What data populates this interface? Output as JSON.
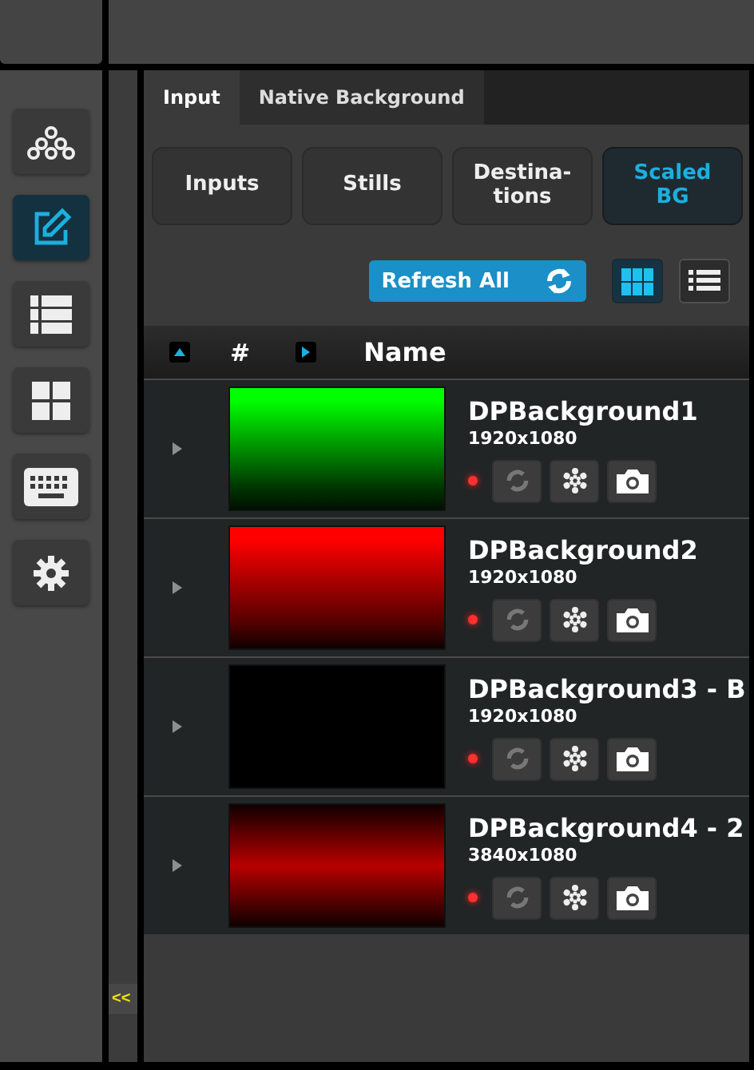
{
  "sidebar": {
    "items": [
      {
        "kind": "hierarchy",
        "selected": false
      },
      {
        "kind": "edit",
        "selected": true
      },
      {
        "kind": "list",
        "selected": false
      },
      {
        "kind": "grid",
        "selected": false
      },
      {
        "kind": "keyboard",
        "selected": false
      },
      {
        "kind": "settings",
        "selected": false
      }
    ]
  },
  "collapse_toggle": "<<",
  "tabs": [
    {
      "label": "Input",
      "selected": true
    },
    {
      "label": "Native Background",
      "selected": false
    }
  ],
  "categories": [
    {
      "label": "Inputs",
      "selected": false
    },
    {
      "label": "Stills",
      "selected": false
    },
    {
      "label": "Destina-tions",
      "selected": false
    },
    {
      "label": "Scaled BG",
      "selected": true
    }
  ],
  "refresh_button": "Refresh All",
  "views": [
    {
      "kind": "grid",
      "selected": true
    },
    {
      "kind": "list",
      "selected": false
    }
  ],
  "table": {
    "columns": [
      "#",
      "Name"
    ],
    "rows": [
      {
        "name": "DPBackground1",
        "resolution": "1920x1080",
        "kind": "green"
      },
      {
        "name": "DPBackground2",
        "resolution": "1920x1080",
        "kind": "red"
      },
      {
        "name": "DPBackground3 - B",
        "resolution": "1920x1080",
        "kind": "black"
      },
      {
        "name": "DPBackground4 - 2",
        "resolution": "3840x1080",
        "kind": "band"
      }
    ]
  }
}
